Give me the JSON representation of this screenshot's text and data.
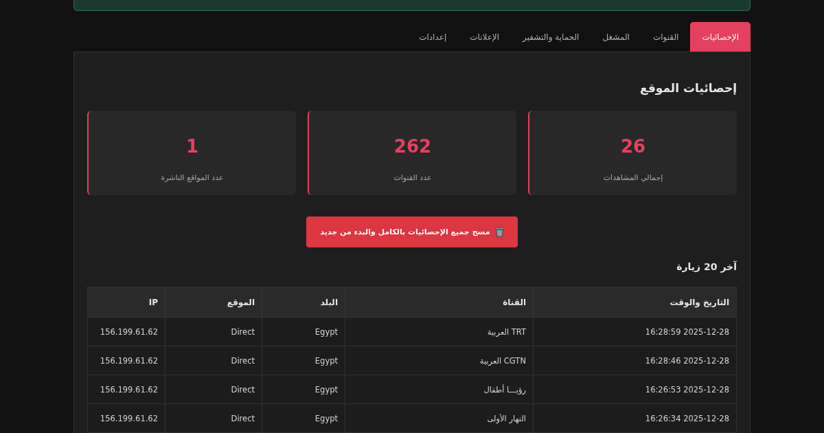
{
  "alert": {
    "kind": "success"
  },
  "tabs": [
    {
      "label": "الإحصائيات",
      "selected": true
    },
    {
      "label": "القنوات",
      "selected": false
    },
    {
      "label": "المشغل",
      "selected": false
    },
    {
      "label": "الحماية والتشفير",
      "selected": false
    },
    {
      "label": "الإعلانات",
      "selected": false
    },
    {
      "label": "إعدادات",
      "selected": false
    }
  ],
  "stats": {
    "title": "إحصائيات الموقع",
    "cards": [
      {
        "value": "26",
        "label": "إجمالي المشاهدات"
      },
      {
        "value": "262",
        "label": "عدد القنوات"
      },
      {
        "value": "1",
        "label": "عدد المواقع الناشرة"
      }
    ]
  },
  "reset_button": {
    "label": "مسح جميع الإحصائيات بالكامل والبدء من جديد"
  },
  "visits": {
    "title": "آخر 20 زيارة",
    "columns": [
      "التاريخ والوقت",
      "القناة",
      "البلد",
      "الموقع",
      "IP"
    ],
    "rows": [
      [
        "2025-12-28 16:28:59",
        "TRT العربية",
        "Egypt",
        "Direct",
        "156.199.61.62"
      ],
      [
        "2025-12-28 16:28:46",
        "CGTN العربية",
        "Egypt",
        "Direct",
        "156.199.61.62"
      ],
      [
        "2025-12-28 16:26:53",
        "رؤيـــا أطفال",
        "Egypt",
        "Direct",
        "156.199.61.62"
      ],
      [
        "2025-12-28 16:26:34",
        "النهار الأولى",
        "Egypt",
        "Direct",
        "156.199.61.62"
      ]
    ]
  }
}
